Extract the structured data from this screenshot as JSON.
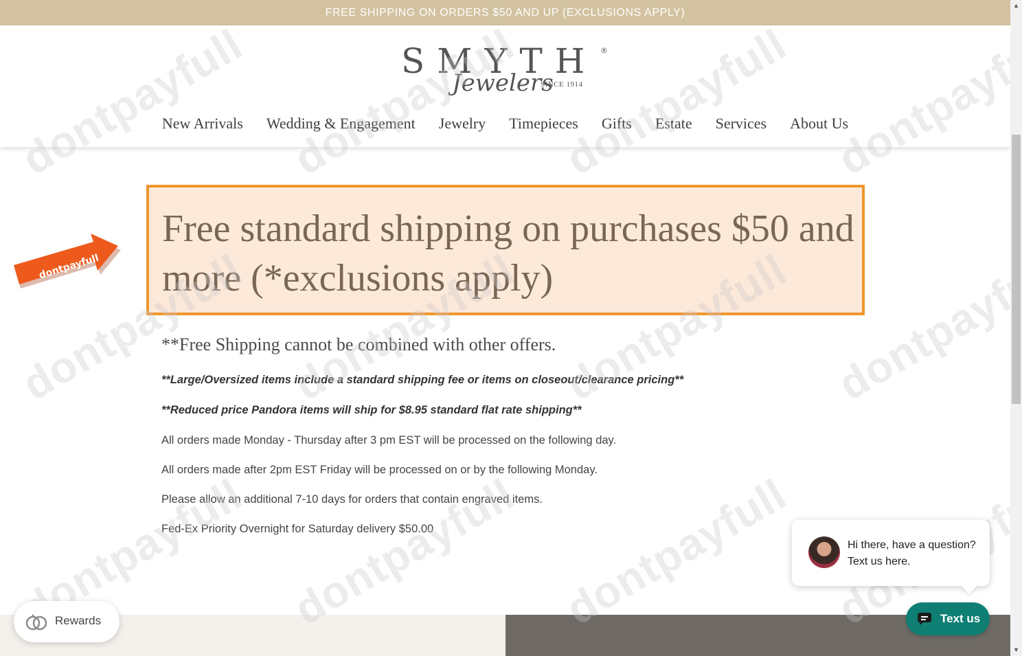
{
  "announcement": "FREE SHIPPING ON ORDERS $50 AND UP (EXCLUSIONS APPLY)",
  "logo": {
    "wordmark": "SMYTH",
    "registered": "®",
    "script": "Jewelers",
    "since": "SINCE 1914"
  },
  "nav": [
    {
      "label": "New Arrivals"
    },
    {
      "label": "Wedding & Engagement"
    },
    {
      "label": "Jewelry"
    },
    {
      "label": "Timepieces"
    },
    {
      "label": "Gifts"
    },
    {
      "label": "Estate"
    },
    {
      "label": "Services"
    },
    {
      "label": "About Us"
    }
  ],
  "highlight": {
    "heading": "Free standard shipping on purchases $50 and more (*exclusions apply)"
  },
  "badge": {
    "label": "dontpayfull"
  },
  "watermark": "dontpayfull",
  "content": {
    "combined": "**Free Shipping cannot be combined with other offers.",
    "note1": "**Large/Oversized items include a standard shipping fee or items on closeout/clearance pricing**",
    "note2": "**Reduced price Pandora items will ship for $8.95 standard flat rate shipping**",
    "para1": "All orders made Monday - Thursday after 3 pm EST will be processed on the following day.",
    "para2": "All orders made after 2pm EST Friday will be processed on or by the following Monday.",
    "para3": "Please allow an additional 7-10 days for orders that contain engraved items.",
    "para4": "Fed-Ex Priority Overnight for Saturday delivery $50.00"
  },
  "rewards": {
    "label": "Rewards",
    "icon": "rings-icon"
  },
  "chat": {
    "message": "Hi there, have a question? Text us here.",
    "button": "Text us",
    "icon": "chat-icon"
  },
  "colors": {
    "announcement_bg": "#d2c29f",
    "highlight_bg": "#fde9d9",
    "highlight_border": "#f0962e",
    "heading_text": "#7a6655",
    "chat_button": "#0f7f74",
    "footer_dark": "#6f6a65",
    "footer_light": "#f4f1ec"
  }
}
